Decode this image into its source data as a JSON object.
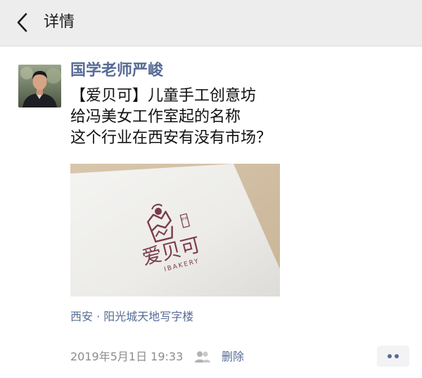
{
  "header": {
    "title": "详情"
  },
  "post": {
    "author": "国学老师严峻",
    "text_lines": [
      "【爱贝可】儿童手工创意坊",
      "给冯美女工作室起的名称",
      "这个行业在西安有没有市场？"
    ],
    "image": {
      "logo_text": "爱贝可",
      "logo_subtext": "IBAKERY",
      "seal_text": "手作"
    },
    "location": "西安 · 阳光城天地写字楼",
    "timestamp": "2019年5月1日 19:33",
    "delete_label": "删除"
  },
  "icons": {
    "back": "chevron-left-icon",
    "visibility": "people-icon",
    "more": "more-dots-icon"
  },
  "colors": {
    "link": "#576b95",
    "header_bg": "#ededed",
    "logo": "#7a3b4a"
  }
}
